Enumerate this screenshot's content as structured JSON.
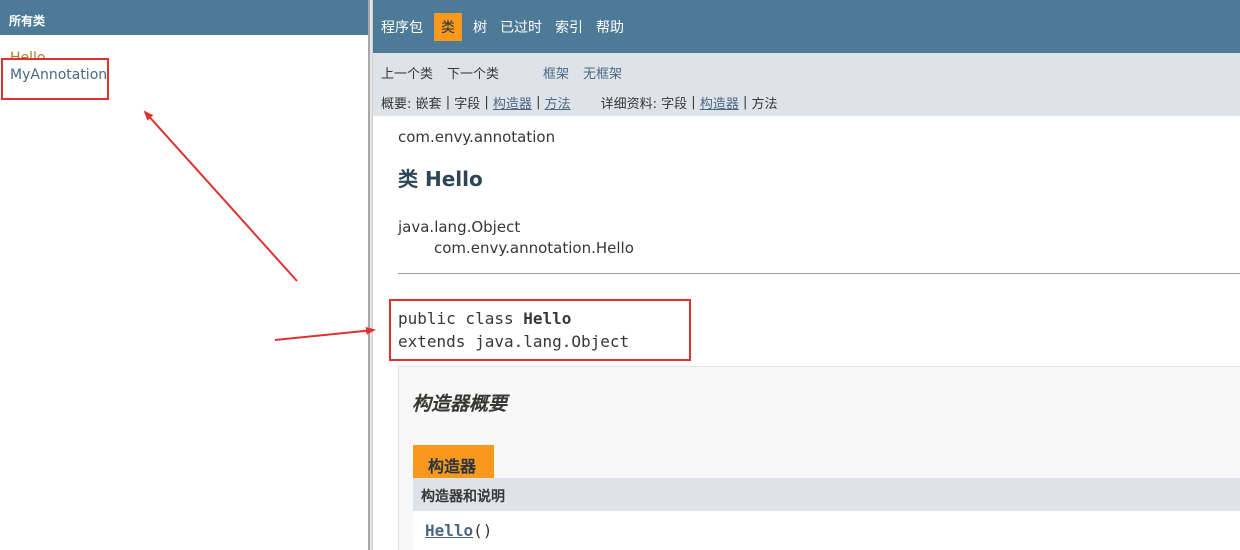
{
  "left": {
    "header": "所有类",
    "classes": [
      {
        "label": "Hello",
        "state": "visited"
      },
      {
        "label": "MyAnnotation",
        "state": "normal"
      }
    ]
  },
  "topnav": {
    "items": [
      "程序包",
      "类",
      "树",
      "已过时",
      "索引",
      "帮助"
    ],
    "active": "类"
  },
  "subnav": {
    "prev_class": "上一个类",
    "next_class": "下一个类",
    "frames": "框架",
    "no_frames": "无框架",
    "summary_label": "概要:",
    "summary_nested": "嵌套",
    "summary_field": "字段",
    "summary_ctor": "构造器",
    "summary_method": "方法",
    "detail_label": "详细资料:",
    "detail_field": "字段",
    "detail_ctor": "构造器",
    "detail_method": "方法",
    "sep": "|"
  },
  "content": {
    "package": "com.envy.annotation",
    "class_title": "类 Hello",
    "inherit_parent": "java.lang.Object",
    "inherit_child": "com.envy.annotation.Hello",
    "sig_prefix": "public class ",
    "sig_name": "Hello",
    "sig_extends": "extends java.lang.Object",
    "ctor_summary_title": "构造器概要",
    "ctor_tab": "构造器",
    "ctor_col_header": "构造器和说明",
    "ctor_name": "Hello",
    "ctor_parens": "()"
  },
  "colors": {
    "nav_bg": "#4d7a97",
    "active_tab": "#f8981d",
    "subnav_bg": "#dee3e9",
    "link": "#4a6782",
    "annotation": "#e03131"
  }
}
